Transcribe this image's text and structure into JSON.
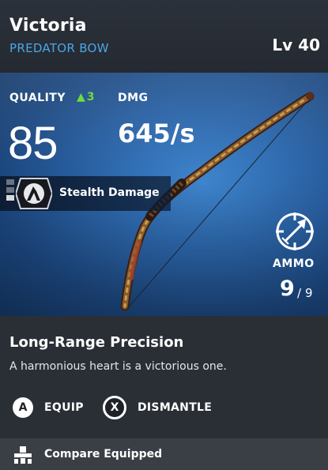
{
  "item": {
    "name": "Victoria",
    "type": "PREDATOR BOW",
    "level": "Lv 40"
  },
  "stats": {
    "quality_label": "QUALITY",
    "quality_increase": "3",
    "quality_value": "85",
    "damage_label": "DMG",
    "damage_value": "645/s"
  },
  "perk": {
    "label": "Stealth Damage",
    "icon": "stealth-damage-icon",
    "tier_bars_filled": 1,
    "tier_bars_total": 3
  },
  "ammo": {
    "label": "AMMO",
    "current": "9",
    "separator": "/",
    "max": "9",
    "icon": "crosshair-arrow-icon"
  },
  "description": {
    "title": "Long-Range Precision",
    "text": "A harmonious heart is a victorious one."
  },
  "actions": {
    "equip_glyph": "A",
    "equip_label": "EQUIP",
    "dismantle_glyph": "X",
    "dismantle_label": "DISMANTLE"
  },
  "footer": {
    "compare_label": "Compare Equipped",
    "compare_icon": "compare-icon"
  },
  "colors": {
    "accent_blue": "#4aa6e6",
    "quality_up_green": "#6fdc3c",
    "hero_background": "#2c66aa",
    "panel_background": "#2a2f36",
    "footer_background": "#3a3f46"
  }
}
